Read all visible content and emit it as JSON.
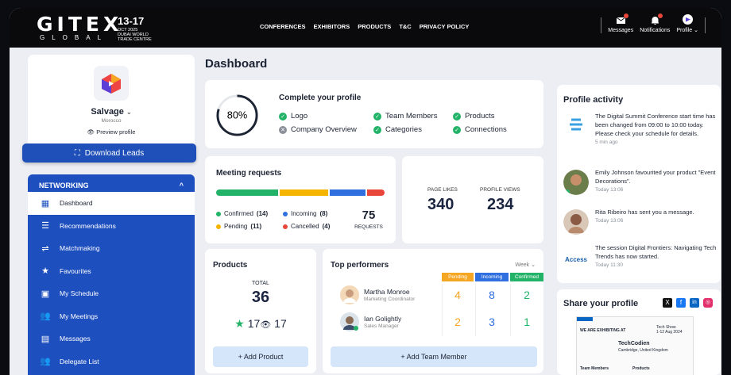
{
  "brand": {
    "logo": "GITEX",
    "logo_sub": "GLOBAL",
    "dates": "13-17",
    "dates_sub": "OCT 2025\nDUBAI WORLD\nTRADE CENTRE"
  },
  "nav": [
    "CONFERENCES",
    "EXHIBITORS",
    "PRODUCTS",
    "T&C",
    "PRIVACY POLICY"
  ],
  "top_icons": {
    "messages": "Messages",
    "notifications": "Notifications",
    "profile": "Profile"
  },
  "company": {
    "name": "Salvage",
    "country": "Morocco",
    "preview": "Preview profile"
  },
  "download_leads": "Download Leads",
  "sidebar": {
    "section": "NETWORKING",
    "items": [
      "Dashboard",
      "Recommendations",
      "Matchmaking",
      "Favourites",
      "My Schedule",
      "My Meetings",
      "Messages",
      "Delegate List"
    ]
  },
  "page_title": "Dashboard",
  "complete": {
    "percent": "80%",
    "percent_value": 80,
    "title": "Complete your profile",
    "items": [
      {
        "label": "Logo",
        "done": true
      },
      {
        "label": "Company Overview",
        "done": false
      },
      {
        "label": "Team Members",
        "done": true
      },
      {
        "label": "Categories",
        "done": true
      },
      {
        "label": "Products",
        "done": true
      },
      {
        "label": "Connections",
        "done": true
      }
    ]
  },
  "meetings": {
    "title": "Meeting requests",
    "confirmed_label": "Confirmed",
    "confirmed": "(14)",
    "pending_label": "Pending",
    "pending": "(11)",
    "incoming_label": "Incoming",
    "incoming": "(8)",
    "cancelled_label": "Cancelled",
    "cancelled": "(4)",
    "total": "75",
    "total_label": "REQUESTS"
  },
  "stats": {
    "likes_label": "PAGE LIKES",
    "likes": "340",
    "views_label": "PROFILE VIEWS",
    "views": "234"
  },
  "products": {
    "title": "Products",
    "total_label": "TOTAL",
    "total": "36",
    "stars": "17",
    "views": "17",
    "add": "+ Add Product"
  },
  "top": {
    "title": "Top performers",
    "range": "Week",
    "cols": [
      "Pending",
      "Incoming",
      "Confirmed"
    ],
    "rows": [
      {
        "name": "Martha Monroe",
        "role": "Marketing Coordinator",
        "vals": [
          "4",
          "8",
          "2"
        ]
      },
      {
        "name": "Ian Golightly",
        "role": "Sales Manager",
        "vals": [
          "2",
          "3",
          "1"
        ]
      }
    ],
    "add": "+ Add Team Member"
  },
  "activity": {
    "title": "Profile activity",
    "items": [
      {
        "text": "The Digital Summit Conference start time has been changed from 09:00 to 10:00 today. Please check your schedule for details.",
        "time": "5 min ago"
      },
      {
        "text": "Emily Johnson favourited your product \"Event Decorations\".",
        "time": "Today 13:06"
      },
      {
        "text": "Rita Ribeiro has sent you a message.",
        "time": "Today 13:06"
      },
      {
        "text": "The session Digital Frontiers: Navigating Tech Trends has now started.",
        "time": "Today 11:30"
      }
    ],
    "access_logo": "Access"
  },
  "share": {
    "title": "Share your profile",
    "preview": {
      "header": "WE ARE EXHIBITING AT",
      "show": "Tech Show",
      "show_dates": "1-12 Aug 2024",
      "company": "TechCodien",
      "location": "Cambridge, United Kingdom",
      "team": "Team Members",
      "products": "Products"
    }
  },
  "colors": {
    "blue": "#1e4fbf",
    "green": "#22b368",
    "yellow": "#f4b400",
    "orange": "#f5a623",
    "red": "#e8463b"
  }
}
